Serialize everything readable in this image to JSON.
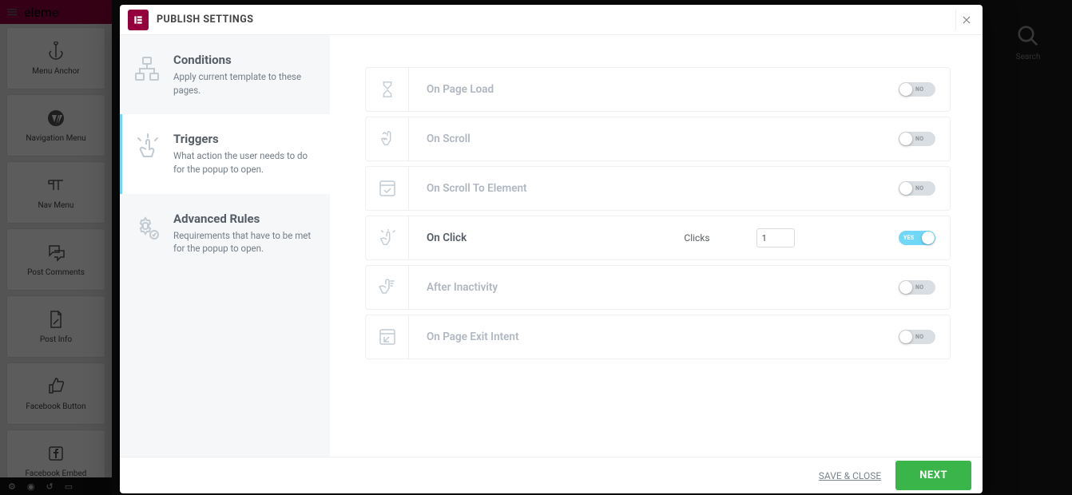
{
  "background_panel": {
    "brand": "eleme",
    "widgets": [
      {
        "label": "Menu Anchor"
      },
      {
        "label": "Navigation Menu"
      },
      {
        "label": "Nav Menu"
      },
      {
        "label": "Post Comments"
      },
      {
        "label": "Post Info"
      },
      {
        "label": "Facebook Button"
      },
      {
        "label": "Facebook Embed"
      }
    ],
    "search_label": "Search"
  },
  "modal": {
    "title": "PUBLISH SETTINGS",
    "sidebar": [
      {
        "title": "Conditions",
        "desc": "Apply current template to these pages."
      },
      {
        "title": "Triggers",
        "desc": "What action the user needs to do for the popup to open."
      },
      {
        "title": "Advanced Rules",
        "desc": "Requirements that have to be met for the popup to open."
      }
    ],
    "active_sidebar_index": 1,
    "triggers": [
      {
        "label": "On Page Load",
        "enabled": false
      },
      {
        "label": "On Scroll",
        "enabled": false
      },
      {
        "label": "On Scroll To Element",
        "enabled": false
      },
      {
        "label": "On Click",
        "enabled": true,
        "extra_label": "Clicks",
        "extra_value": "1"
      },
      {
        "label": "After Inactivity",
        "enabled": false
      },
      {
        "label": "On Page Exit Intent",
        "enabled": false
      }
    ],
    "toggle_yes": "YES",
    "toggle_no": "NO",
    "footer": {
      "save": "SAVE & CLOSE",
      "next": "NEXT"
    }
  }
}
